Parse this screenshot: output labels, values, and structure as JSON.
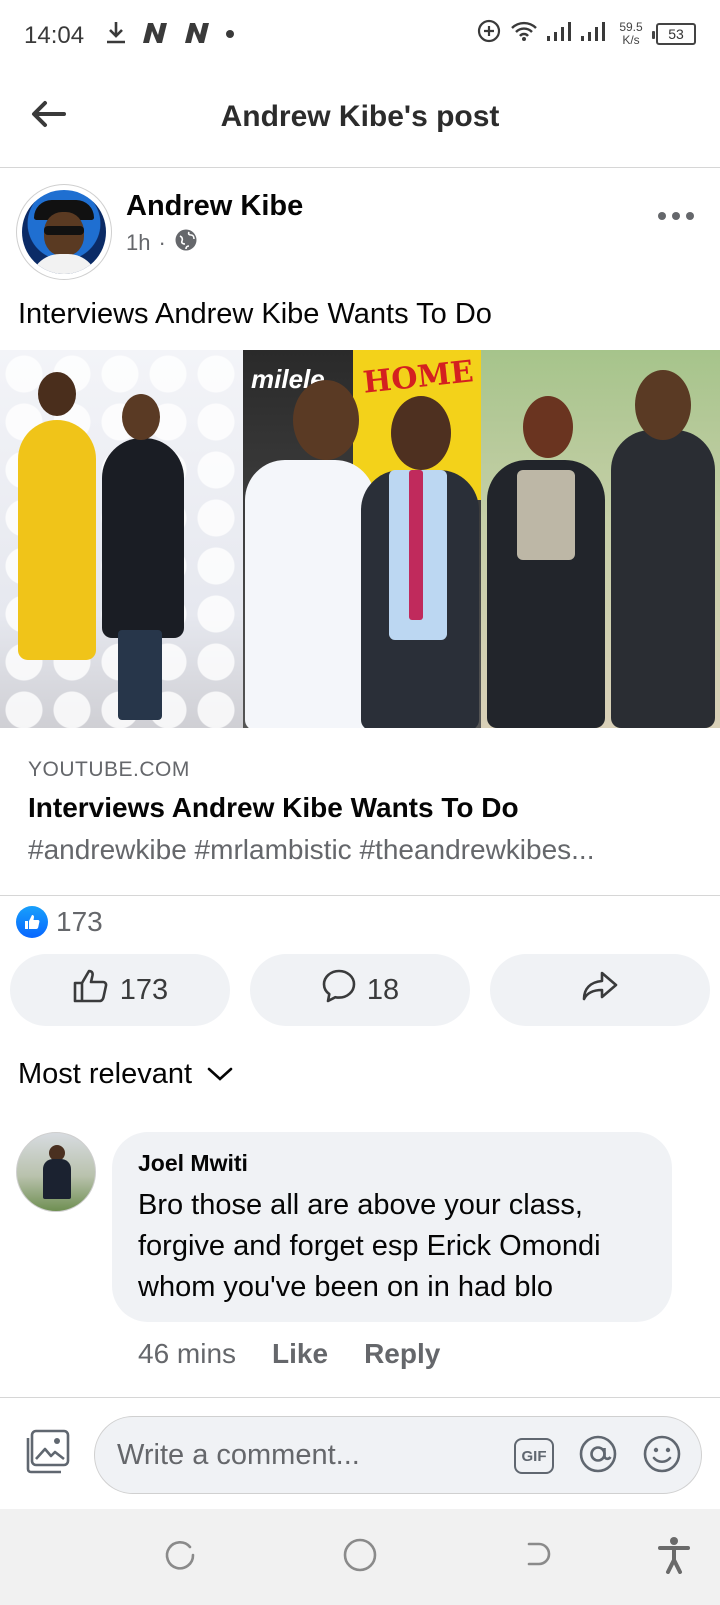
{
  "status_bar": {
    "time": "14:04",
    "speed_value": "59.5",
    "speed_unit": "K/s",
    "battery": "53"
  },
  "header": {
    "title": "Andrew Kibe's post"
  },
  "post": {
    "author": "Andrew Kibe",
    "time_ago": "1h",
    "separator": "·",
    "text": "Interviews Andrew Kibe Wants To Do",
    "image_brand_text": "milele",
    "image_banner_text": "HOME"
  },
  "link": {
    "domain": "YOUTUBE.COM",
    "title": "Interviews Andrew Kibe Wants To Do",
    "description": "#andrewkibe #mrlambistic #theandrewkibes..."
  },
  "reactions": {
    "like_count": "173"
  },
  "actions": {
    "like_count": "173",
    "comment_count": "18"
  },
  "comments": {
    "sort_label": "Most relevant",
    "items": [
      {
        "name": "Joel Mwiti",
        "text": "Bro those all are above your class, forgive and forget esp Erick Omondi whom you've been on in had blo",
        "time": "46 mins",
        "like_label": "Like",
        "reply_label": "Reply"
      }
    ]
  },
  "composer": {
    "placeholder": "Write a comment...",
    "gif_label": "GIF"
  },
  "colors": {
    "brand_blue": "#0866ff",
    "secondary_text": "#65676b",
    "button_bg": "#f0f2f5"
  },
  "icons": {
    "status_left": [
      "download-icon",
      "n-app-icon",
      "n-app-icon",
      "dot-icon"
    ],
    "status_right": [
      "data-saver-icon",
      "wifi-icon",
      "signal-icon",
      "signal-icon",
      "battery-icon"
    ],
    "nav": [
      "recents-icon",
      "home-icon",
      "back-icon",
      "accessibility-icon"
    ]
  }
}
